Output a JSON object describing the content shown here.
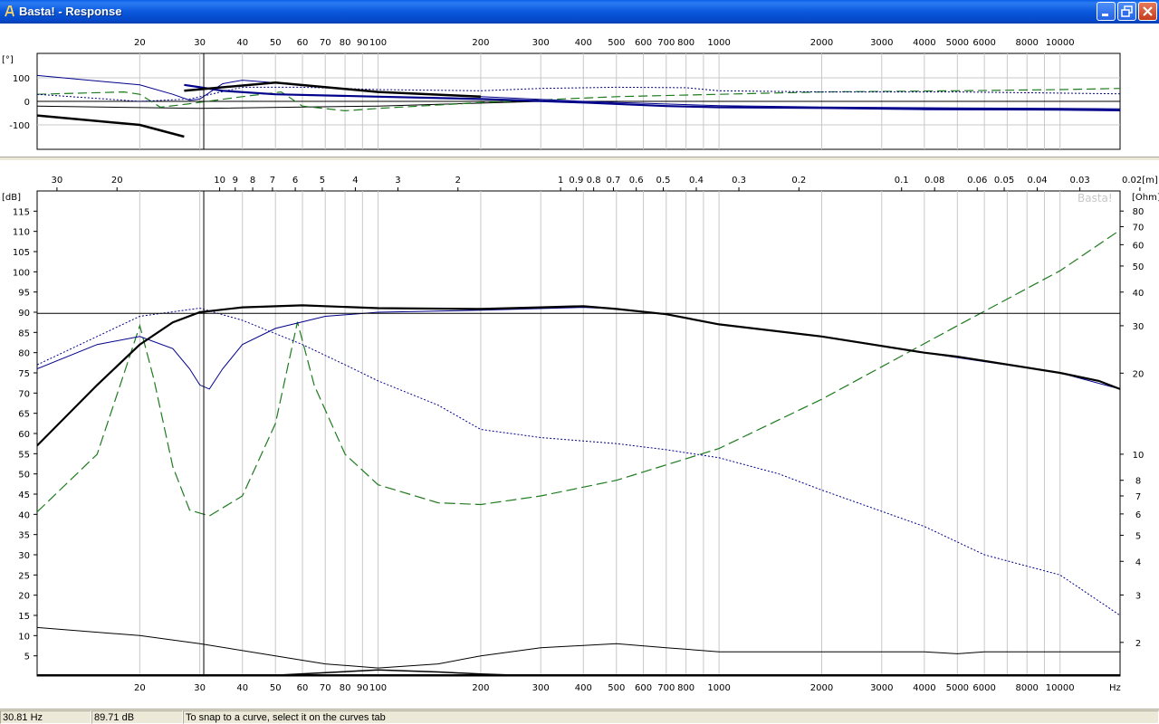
{
  "window": {
    "title": "Basta! - Response",
    "buttons": {
      "minimize": "minimize",
      "maximize": "maximize",
      "close": "close"
    }
  },
  "phase_plot": {
    "unit_label": "[°]",
    "freq_ticks": [
      "20",
      "30",
      "40",
      "50",
      "60",
      "70",
      "80",
      "90",
      "100",
      "200",
      "300",
      "400",
      "500",
      "600",
      "700",
      "800",
      "1000",
      "2000",
      "3000",
      "4000",
      "5000",
      "6000",
      "8000",
      "10000"
    ],
    "y_ticks": [
      "100",
      "0",
      "-100"
    ]
  },
  "response_plot": {
    "left_unit": "[dB]",
    "right_unit": "[Ohm]",
    "watermark": "Basta!",
    "hz_label": "Hz",
    "db_ticks": [
      "115",
      "110",
      "105",
      "100",
      "95",
      "90",
      "85",
      "80",
      "75",
      "70",
      "65",
      "60",
      "55",
      "50",
      "45",
      "40",
      "35",
      "30",
      "25",
      "20",
      "15",
      "10",
      "5"
    ],
    "ohm_ticks": [
      "80",
      "70",
      "60",
      "50",
      "40",
      "30",
      "20",
      "10",
      "8",
      "7",
      "6",
      "5",
      "4",
      "3",
      "2"
    ],
    "wavelength_ticks": [
      "30",
      "20",
      "10",
      "9",
      "8",
      "7",
      "6",
      "5",
      "4",
      "3",
      "2",
      "1",
      "0.9",
      "0.8",
      "0.7",
      "0.6",
      "0.5",
      "0.4",
      "0.3",
      "0.2",
      "0.1",
      "0.08",
      "0.06",
      "0.05",
      "0.04",
      "0.03",
      "0.02[m]"
    ],
    "freq_ticks": [
      "20",
      "30",
      "40",
      "50",
      "60",
      "70",
      "80",
      "90",
      "100",
      "200",
      "300",
      "400",
      "500",
      "600",
      "700",
      "800",
      "1000",
      "2000",
      "3000",
      "4000",
      "5000",
      "6000",
      "8000",
      "10000"
    ]
  },
  "cursor": {
    "frequency_hz": 30.81,
    "level_db": 89.71
  },
  "status": {
    "frequency": "30.81 Hz",
    "level": "89.71 dB",
    "hint": "To snap to a curve, select it on the curves tab"
  },
  "colors": {
    "spl_total": "#000000",
    "spl_driver": "#00008b",
    "impedance": "#1e7b1e",
    "grid": "#c8c8c8",
    "titlebar": "#0a5ee8"
  },
  "curves": {
    "response": {
      "spl_total": [
        [
          10,
          57
        ],
        [
          15,
          72
        ],
        [
          20,
          82
        ],
        [
          25,
          87.5
        ],
        [
          30,
          90
        ],
        [
          40,
          91.2
        ],
        [
          60,
          91.7
        ],
        [
          100,
          91
        ],
        [
          200,
          90.8
        ],
        [
          300,
          91.2
        ],
        [
          400,
          91.5
        ],
        [
          500,
          90.8
        ],
        [
          700,
          89.5
        ],
        [
          1000,
          87
        ],
        [
          2000,
          84
        ],
        [
          4000,
          80
        ],
        [
          5000,
          79
        ],
        [
          10000,
          75
        ],
        [
          13000,
          73
        ],
        [
          15000,
          71
        ]
      ],
      "spl_driver": [
        [
          10,
          76
        ],
        [
          15,
          82
        ],
        [
          20,
          84
        ],
        [
          25,
          81
        ],
        [
          28,
          76
        ],
        [
          30,
          72
        ],
        [
          32,
          71
        ],
        [
          35,
          76
        ],
        [
          40,
          82
        ],
        [
          50,
          86
        ],
        [
          70,
          89
        ],
        [
          100,
          90
        ],
        [
          200,
          90.5
        ],
        [
          400,
          91.2
        ],
        [
          500,
          90.8
        ],
        [
          700,
          89.5
        ],
        [
          1000,
          87
        ],
        [
          2000,
          84
        ],
        [
          4000,
          80
        ],
        [
          10000,
          75
        ],
        [
          15000,
          71
        ]
      ],
      "spl_alt": [
        [
          10,
          77
        ],
        [
          20,
          89
        ],
        [
          30,
          91
        ],
        [
          40,
          88
        ],
        [
          60,
          82
        ],
        [
          80,
          77
        ],
        [
          100,
          73
        ],
        [
          150,
          67
        ],
        [
          200,
          61
        ],
        [
          300,
          59
        ],
        [
          500,
          57.5
        ],
        [
          700,
          56
        ],
        [
          1000,
          54
        ],
        [
          1500,
          50
        ],
        [
          2000,
          46
        ],
        [
          4000,
          37
        ],
        [
          6000,
          30
        ],
        [
          10000,
          25
        ],
        [
          15000,
          15
        ]
      ],
      "impedance": [
        [
          10,
          6.1
        ],
        [
          15,
          10
        ],
        [
          18,
          20
        ],
        [
          20,
          30
        ],
        [
          22,
          19
        ],
        [
          25,
          9
        ],
        [
          28,
          6.2
        ],
        [
          32,
          5.9
        ],
        [
          40,
          7
        ],
        [
          50,
          13
        ],
        [
          58,
          31
        ],
        [
          65,
          18
        ],
        [
          80,
          10
        ],
        [
          100,
          7.7
        ],
        [
          150,
          6.6
        ],
        [
          200,
          6.5
        ],
        [
          300,
          7
        ],
        [
          500,
          8
        ],
        [
          1000,
          10.5
        ],
        [
          2000,
          16
        ],
        [
          5000,
          30
        ],
        [
          10000,
          48
        ],
        [
          15000,
          68
        ]
      ],
      "excursion": [
        [
          10,
          12
        ],
        [
          20,
          10
        ],
        [
          30,
          8
        ],
        [
          50,
          5
        ],
        [
          70,
          3
        ],
        [
          100,
          2
        ],
        [
          150,
          3
        ],
        [
          200,
          5
        ],
        [
          300,
          7
        ],
        [
          500,
          8
        ],
        [
          700,
          7
        ],
        [
          1000,
          6
        ],
        [
          2000,
          6
        ],
        [
          4000,
          6
        ],
        [
          5000,
          5.5
        ],
        [
          6000,
          6
        ],
        [
          10000,
          6
        ],
        [
          15000,
          6
        ]
      ],
      "excursion2": [
        [
          10,
          0
        ],
        [
          50,
          0.2
        ],
        [
          100,
          1.5
        ],
        [
          150,
          1
        ],
        [
          200,
          0.5
        ],
        [
          300,
          0
        ]
      ]
    },
    "phase": {
      "spl_total": [
        [
          27,
          70
        ],
        [
          30,
          60
        ],
        [
          35,
          45
        ],
        [
          50,
          30
        ],
        [
          100,
          20
        ],
        [
          200,
          10
        ],
        [
          400,
          -5
        ],
        [
          700,
          -20
        ],
        [
          1000,
          -25
        ],
        [
          2000,
          -28
        ],
        [
          4000,
          -33
        ],
        [
          10000,
          -35
        ],
        [
          15000,
          -38
        ]
      ],
      "spl_driver": [
        [
          10,
          110
        ],
        [
          20,
          70
        ],
        [
          25,
          30
        ],
        [
          28,
          5
        ],
        [
          30,
          10
        ],
        [
          35,
          75
        ],
        [
          40,
          90
        ],
        [
          60,
          70
        ],
        [
          100,
          40
        ],
        [
          200,
          20
        ],
        [
          400,
          0
        ],
        [
          1000,
          -18
        ],
        [
          2000,
          -24
        ],
        [
          5000,
          -28
        ],
        [
          10000,
          -30
        ],
        [
          15000,
          -32
        ]
      ],
      "spl_alt": [
        [
          10,
          30
        ],
        [
          20,
          0
        ],
        [
          28,
          10
        ],
        [
          40,
          60
        ],
        [
          60,
          60
        ],
        [
          100,
          50
        ],
        [
          200,
          45
        ],
        [
          300,
          55
        ],
        [
          500,
          60
        ],
        [
          800,
          58
        ],
        [
          1000,
          45
        ],
        [
          2000,
          40
        ],
        [
          5000,
          40
        ],
        [
          10000,
          35
        ],
        [
          15000,
          32
        ]
      ],
      "impedance": [
        [
          10,
          30
        ],
        [
          18,
          40
        ],
        [
          20,
          30
        ],
        [
          23,
          -25
        ],
        [
          28,
          -10
        ],
        [
          40,
          20
        ],
        [
          52,
          40
        ],
        [
          60,
          -20
        ],
        [
          80,
          -40
        ],
        [
          100,
          -30
        ],
        [
          200,
          -5
        ],
        [
          500,
          20
        ],
        [
          1000,
          30
        ],
        [
          2000,
          40
        ],
        [
          5000,
          45
        ],
        [
          10000,
          50
        ],
        [
          15000,
          55
        ]
      ],
      "excursion": [
        [
          10,
          -20
        ],
        [
          30,
          -30
        ],
        [
          100,
          -20
        ],
        [
          300,
          0
        ],
        [
          1000,
          0
        ],
        [
          10000,
          0
        ]
      ],
      "gd_lower": [
        [
          10,
          -60
        ],
        [
          20,
          -100
        ],
        [
          27,
          -150
        ]
      ],
      "gd_upper": [
        [
          27,
          45
        ],
        [
          50,
          80
        ],
        [
          100,
          40
        ],
        [
          200,
          20
        ]
      ]
    }
  }
}
